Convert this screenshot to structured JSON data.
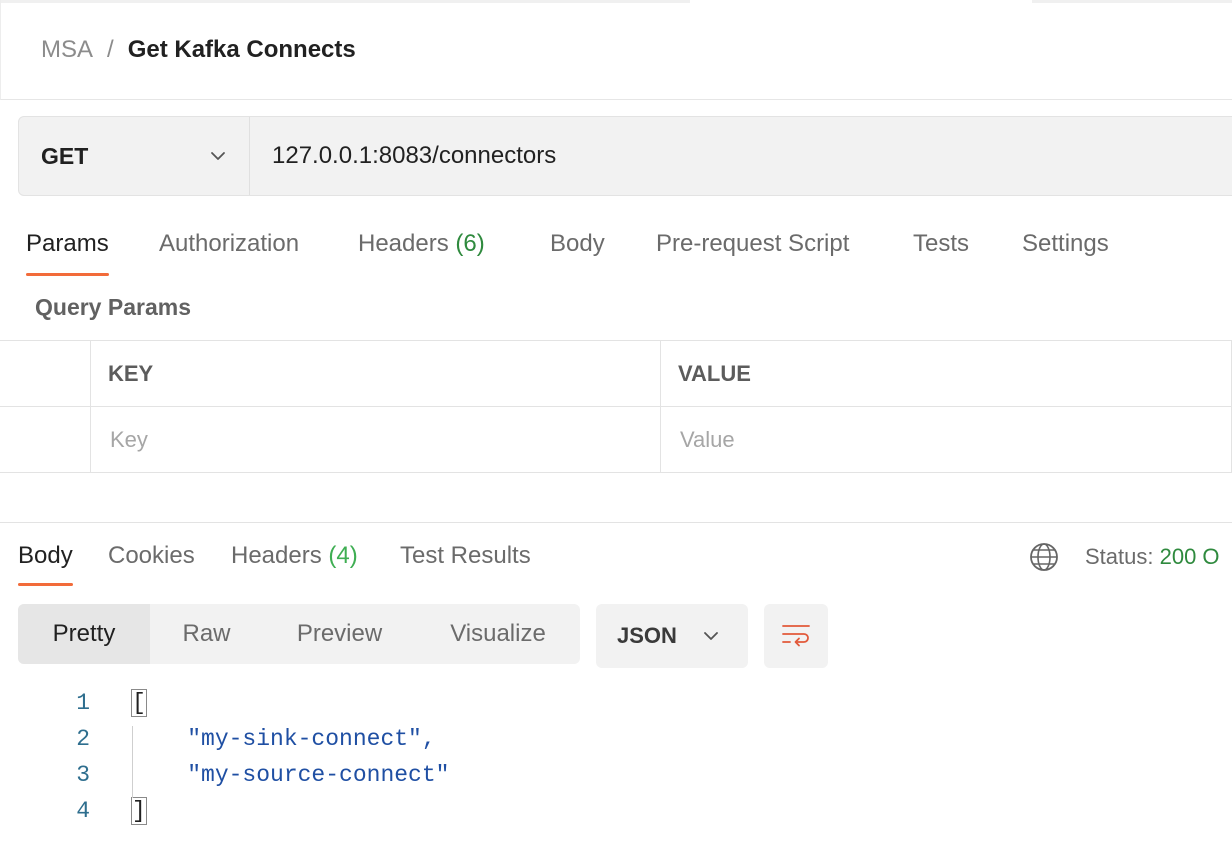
{
  "breadcrumb": {
    "parent": "MSA",
    "separator": "/",
    "current": "Get Kafka Connects"
  },
  "request": {
    "method": "GET",
    "url": "127.0.0.1:8083/connectors"
  },
  "request_tabs": [
    {
      "label": "Params",
      "count": ""
    },
    {
      "label": "Authorization",
      "count": ""
    },
    {
      "label": "Headers",
      "count": "(6)"
    },
    {
      "label": "Body",
      "count": ""
    },
    {
      "label": "Pre-request Script",
      "count": ""
    },
    {
      "label": "Tests",
      "count": ""
    },
    {
      "label": "Settings",
      "count": ""
    }
  ],
  "query_params": {
    "title": "Query Params",
    "columns": [
      "KEY",
      "VALUE"
    ],
    "placeholders": {
      "key": "Key",
      "value": "Value"
    }
  },
  "response_tabs": [
    {
      "label": "Body",
      "count": ""
    },
    {
      "label": "Cookies",
      "count": ""
    },
    {
      "label": "Headers",
      "count": "(4)"
    },
    {
      "label": "Test Results",
      "count": ""
    }
  ],
  "status": {
    "label": "Status:",
    "value": "200 O"
  },
  "view_modes": [
    "Pretty",
    "Raw",
    "Preview",
    "Visualize"
  ],
  "format": "JSON",
  "code_lines": [
    {
      "num": "1",
      "text": "["
    },
    {
      "num": "2",
      "text": "    \"my-sink-connect\","
    },
    {
      "num": "3",
      "text": "    \"my-source-connect\""
    },
    {
      "num": "4",
      "text": "]"
    }
  ],
  "colors": {
    "accent": "#f26b3a",
    "success": "#2f8a3e"
  }
}
